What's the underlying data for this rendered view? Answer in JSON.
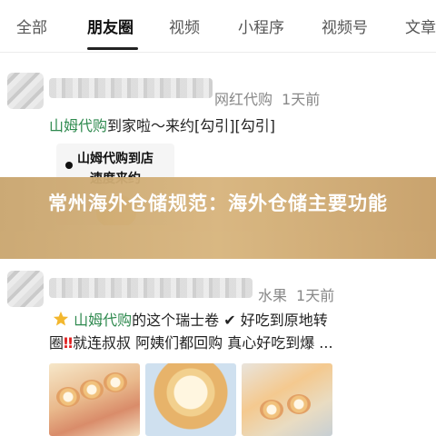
{
  "tabs": [
    {
      "label": "全部"
    },
    {
      "label": "朋友圈"
    },
    {
      "label": "视频"
    },
    {
      "label": "小程序"
    },
    {
      "label": "视频号"
    },
    {
      "label": "文章"
    }
  ],
  "post1": {
    "name_suffix": "网红代购",
    "time": "1天前",
    "text_link": "山姆代购",
    "text_rest": "到家啦～来约[勾引][勾引]",
    "sticker_line1": "山姆代购到店",
    "sticker_line2": "速度来约"
  },
  "banner": {
    "title": "常州海外仓储规范：海外仓储主要功能"
  },
  "post2": {
    "name_suffix": "水果",
    "time": "1天前",
    "line1_link": "山姆代购",
    "line1_rest": "的这个瑞士卷 ✔ 好吃到原地转",
    "line2_start": "圈",
    "line2_bang": "‼",
    "line2_rest": "就连叔叔 阿姨们都回购 真心好吃到爆 ..."
  },
  "colors": {
    "link": "#2f8a4f",
    "banner": "#d2ae76"
  }
}
